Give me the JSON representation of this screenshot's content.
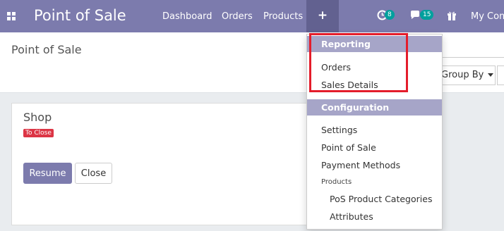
{
  "navbar": {
    "brand": "Point of Sale",
    "links": [
      "Dashboard",
      "Orders",
      "Products"
    ],
    "plus_label": "+",
    "activity_count": "8",
    "messages_count": "15",
    "company": "My Com"
  },
  "control_panel": {
    "breadcrumb": "Point of Sale",
    "group_by_label": "Group By"
  },
  "shop_card": {
    "name": "Shop",
    "status": "To Close",
    "resume_label": "Resume",
    "close_label": "Close"
  },
  "dropdown": {
    "reporting_header": "Reporting",
    "reporting_items": [
      "Orders",
      "Sales Details"
    ],
    "configuration_header": "Configuration",
    "config_items": [
      "Settings",
      "Point of Sale",
      "Payment Methods"
    ],
    "products_subheader": "Products",
    "product_items": [
      "PoS Product Categories",
      "Attributes"
    ]
  },
  "colors": {
    "navbar": "#7c7bad",
    "navbar_active": "#626190",
    "dropdown_header": "#a6a5c8",
    "badge": "#00a09d",
    "status_badge": "#dc3545",
    "highlight": "#e41d2b"
  }
}
